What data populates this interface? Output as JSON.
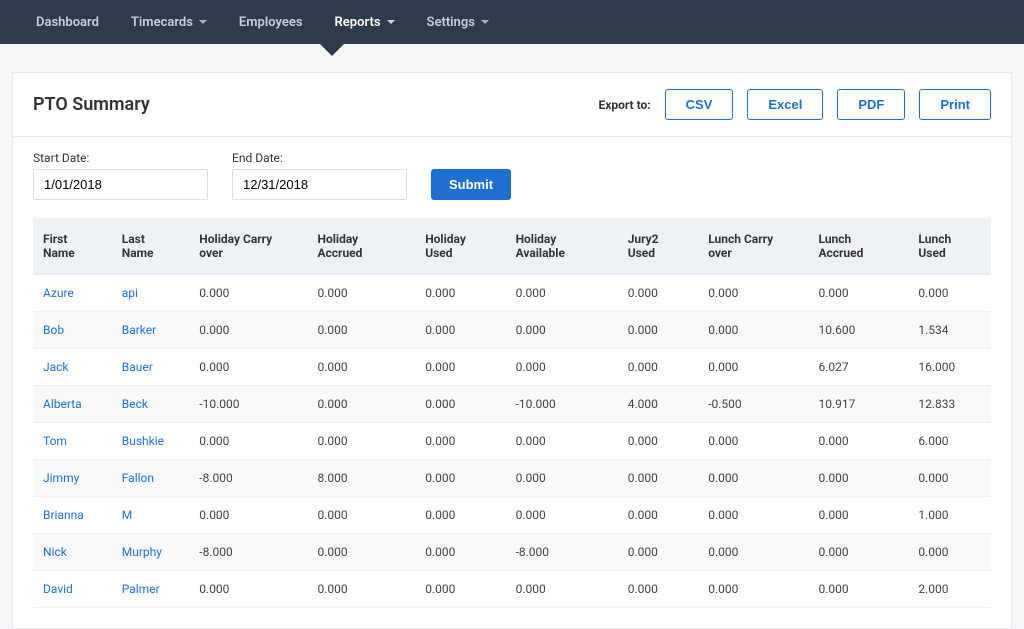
{
  "nav": {
    "items": [
      {
        "label": "Dashboard",
        "caret": false,
        "active": false
      },
      {
        "label": "Timecards",
        "caret": true,
        "active": false
      },
      {
        "label": "Employees",
        "caret": false,
        "active": false
      },
      {
        "label": "Reports",
        "caret": true,
        "active": true
      },
      {
        "label": "Settings",
        "caret": true,
        "active": false
      }
    ]
  },
  "header": {
    "title": "PTO Summary",
    "export_label": "Export to:",
    "buttons": {
      "csv": "CSV",
      "excel": "Excel",
      "pdf": "PDF",
      "print": "Print"
    }
  },
  "filters": {
    "start_label": "Start Date:",
    "start_value": "1/01/2018",
    "end_label": "End Date:",
    "end_value": "12/31/2018",
    "submit": "Submit"
  },
  "table": {
    "columns": [
      "First Name",
      "Last Name",
      "Holiday Carry over",
      "Holiday Accrued",
      "Holiday Used",
      "Holiday Available",
      "Jury2 Used",
      "Lunch Carry over",
      "Lunch Accrued",
      "Lunch Used"
    ],
    "rows": [
      {
        "first": "Azure",
        "last": "api",
        "c": [
          "0.000",
          "0.000",
          "0.000",
          "0.000",
          "0.000",
          "0.000",
          "0.000",
          "0.000"
        ]
      },
      {
        "first": "Bob",
        "last": "Barker",
        "c": [
          "0.000",
          "0.000",
          "0.000",
          "0.000",
          "0.000",
          "0.000",
          "10.600",
          "1.534"
        ]
      },
      {
        "first": "Jack",
        "last": "Bauer",
        "c": [
          "0.000",
          "0.000",
          "0.000",
          "0.000",
          "0.000",
          "0.000",
          "6.027",
          "16.000"
        ]
      },
      {
        "first": "Alberta",
        "last": "Beck",
        "c": [
          "-10.000",
          "0.000",
          "0.000",
          "-10.000",
          "4.000",
          "-0.500",
          "10.917",
          "12.833"
        ]
      },
      {
        "first": "Tom",
        "last": "Bushkie",
        "c": [
          "0.000",
          "0.000",
          "0.000",
          "0.000",
          "0.000",
          "0.000",
          "0.000",
          "6.000"
        ]
      },
      {
        "first": "Jimmy",
        "last": "Fallon",
        "c": [
          "-8.000",
          "8.000",
          "0.000",
          "0.000",
          "0.000",
          "0.000",
          "0.000",
          "0.000"
        ]
      },
      {
        "first": "Brianna",
        "last": "M",
        "c": [
          "0.000",
          "0.000",
          "0.000",
          "0.000",
          "0.000",
          "0.000",
          "0.000",
          "1.000"
        ]
      },
      {
        "first": "Nick",
        "last": "Murphy",
        "c": [
          "-8.000",
          "0.000",
          "0.000",
          "-8.000",
          "0.000",
          "0.000",
          "0.000",
          "0.000"
        ]
      },
      {
        "first": "David",
        "last": "Palmer",
        "c": [
          "0.000",
          "0.000",
          "0.000",
          "0.000",
          "0.000",
          "0.000",
          "0.000",
          "2.000"
        ]
      }
    ]
  }
}
